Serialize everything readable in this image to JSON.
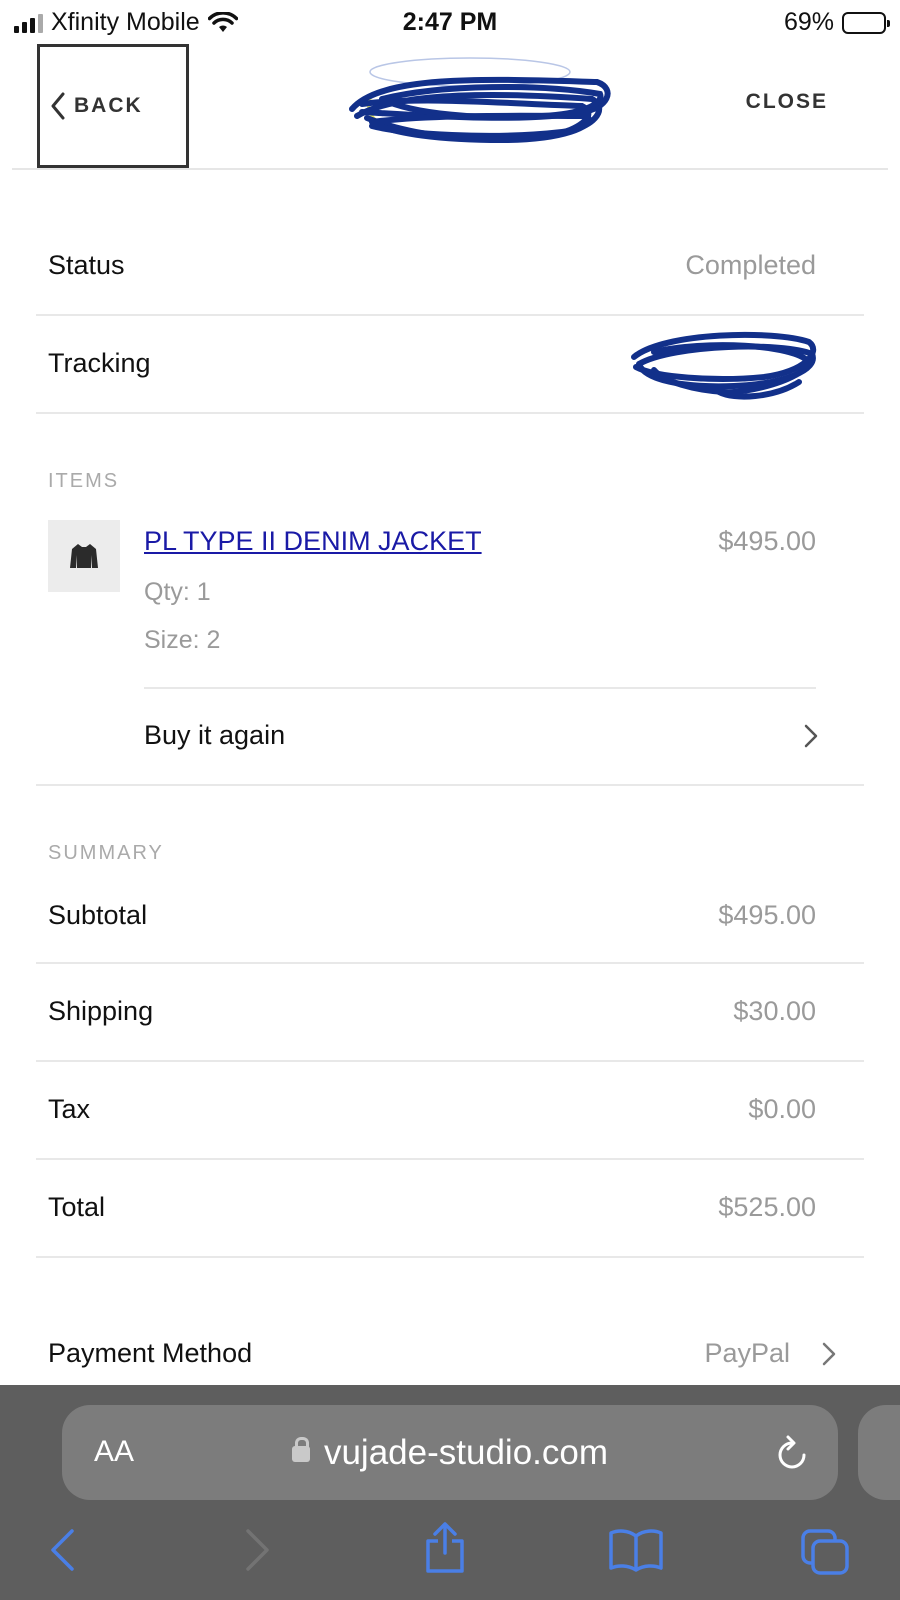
{
  "status_bar": {
    "carrier": "Xfinity Mobile",
    "time": "2:47 PM",
    "battery": "69%",
    "battery_level": 0.69
  },
  "header": {
    "back_label": "BACK",
    "close_label": "CLOSE"
  },
  "order": {
    "status_label": "Status",
    "status_value": "Completed",
    "tracking_label": "Tracking"
  },
  "items_section": {
    "title": "ITEMS",
    "items": [
      {
        "name": "PL TYPE II DENIM JACKET",
        "price": "$495.00",
        "qty": "Qty: 1",
        "size": "Size: 2"
      }
    ],
    "buy_again_label": "Buy it again"
  },
  "summary": {
    "title": "SUMMARY",
    "rows": [
      {
        "label": "Subtotal",
        "value": "$495.00"
      },
      {
        "label": "Shipping",
        "value": "$30.00"
      },
      {
        "label": "Tax",
        "value": "$0.00"
      },
      {
        "label": "Total",
        "value": "$525.00"
      }
    ]
  },
  "payment": {
    "label": "Payment Method",
    "value": "PayPal"
  },
  "browser": {
    "aa_label": "AA",
    "url": "vujade-studio.com"
  },
  "colors": {
    "link": "#1a1aa6",
    "redaction": "#12308a",
    "safari_bar": "#5e5e5e",
    "safari_icon": "#4a7fe6"
  }
}
